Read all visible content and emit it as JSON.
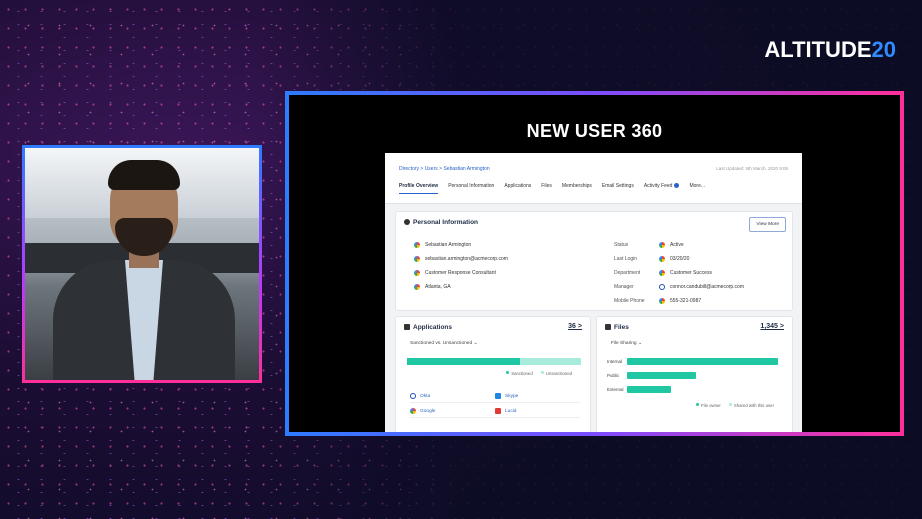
{
  "brand": {
    "text": "ALTITUDE",
    "number": "20"
  },
  "screen_title": "NEW USER 360",
  "app": {
    "breadcrumb": "Directory > Users > Sebastian Armington",
    "updated": "Last Updated: 5th March, 2020 9:05",
    "tabs": [
      "Profile Overview",
      "Personal Information",
      "Applications",
      "Files",
      "Memberships",
      "Email Settings",
      "Activity Feed",
      "More..."
    ],
    "personal_info": {
      "title": "Personal Information",
      "view_more": "View More",
      "name": "Sebastian Armington",
      "email": "sebastian.armington@acmecorp.com",
      "role": "Customer Response Consultant",
      "location": "Atlanta, GA",
      "fields": [
        {
          "key": "Status",
          "value": "Active"
        },
        {
          "key": "Last Login",
          "value": "03/20/20"
        },
        {
          "key": "Department",
          "value": "Customer Success"
        },
        {
          "key": "Manager",
          "value": "connor.candubill@acmecorp.com"
        },
        {
          "key": "Mobile Phone",
          "value": "555-321-0987"
        }
      ]
    },
    "applications": {
      "title": "Applications",
      "count": "36",
      "filter": "Sanctioned vs. Unsanctioned",
      "sanctioned_fraction": 0.65,
      "legend": [
        "Sanctioned",
        "Unsanctioned"
      ],
      "items": [
        "Okta",
        "Skype",
        "Google",
        "Lucid"
      ]
    },
    "files": {
      "title": "Files",
      "count": "1,345",
      "filter": "File Sharing",
      "rows": [
        {
          "label": "Internal",
          "fraction": 1.0
        },
        {
          "label": "Public",
          "fraction": 0.46
        },
        {
          "label": "External",
          "fraction": 0.29
        }
      ],
      "legend": [
        "File owner",
        "Shared with this user"
      ]
    }
  },
  "colors": {
    "accent_blue": "#2a63c6",
    "bar_green": "#1fc7a2",
    "bar_light": "#a7ebdd"
  }
}
